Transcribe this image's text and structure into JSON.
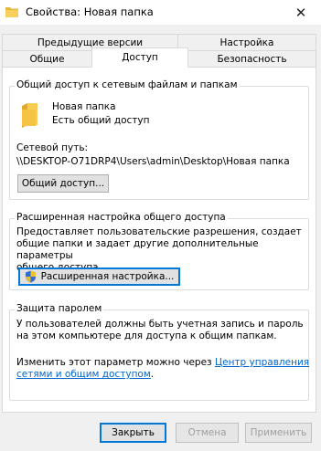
{
  "window": {
    "title": "Свойства: Новая папка",
    "close_label": "✕"
  },
  "tabs": {
    "row1": [
      "Предыдущие версии",
      "Настройка"
    ],
    "row2": [
      "Общие",
      "Доступ",
      "Безопасность"
    ]
  },
  "network_share": {
    "legend": "Общий доступ к сетевым файлам и папкам",
    "folder_name": "Новая папка",
    "status": "Есть общий доступ",
    "path_label": "Сетевой путь:",
    "path_value": "\\\\DESKTOP-O71DRP4\\Users\\admin\\Desktop\\Новая папка",
    "share_button": "Общий доступ..."
  },
  "advanced": {
    "legend": "Расширенная настройка общего доступа",
    "description_lines": [
      "Предоставляет пользовательские разрешения, создает",
      "общие папки и задает другие дополнительные параметры",
      "общего доступа."
    ],
    "button": "Расширенная настройка..."
  },
  "password": {
    "legend": "Защита паролем",
    "description_lines": [
      "У пользователей должны быть учетная запись и пароль",
      "на этом компьютере для доступа к общим папкам."
    ],
    "change_text": "Изменить этот параметр можно через ",
    "link_line1": "Центр управления",
    "link_line2": "сетями и общим доступом",
    "after_link": "."
  },
  "footer": {
    "close": "Закрыть",
    "cancel": "Отмена",
    "apply": "Применить"
  },
  "colors": {
    "accent": "#0078d7",
    "link": "#0066cc",
    "folder": "#f5c445"
  },
  "icons": {
    "title": "folder-icon",
    "folder": "folder-icon",
    "shield": "uac-shield-icon"
  }
}
